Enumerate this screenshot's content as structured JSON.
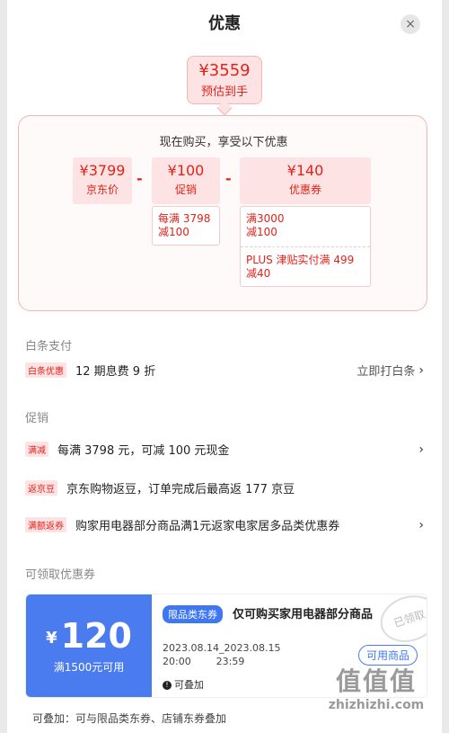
{
  "header": {
    "title": "优惠",
    "close_icon": "×"
  },
  "estimate": {
    "price": "¥3559",
    "label": "预估到手"
  },
  "calc": {
    "heading": "现在购买，享受以下优惠",
    "base": {
      "value": "¥3799",
      "label": "京东价"
    },
    "minus1": "-",
    "promo": {
      "value": "¥100",
      "label": "促销"
    },
    "minus2": "-",
    "coupon": {
      "value": "¥140",
      "label": "优惠券"
    },
    "promo_detail": [
      "每满 3798",
      "减100"
    ],
    "coupon_detail_1": [
      "满3000",
      "减100"
    ],
    "coupon_detail_2": [
      "PLUS 津贴实付满 499",
      "减40"
    ]
  },
  "baitiao": {
    "section_label": "白条支付",
    "tag": "白条优惠",
    "text": "12 期息费 9 折",
    "action": "立即打白条",
    "chevron": "›"
  },
  "promotions": {
    "section_label": "促销",
    "items": [
      {
        "tag": "满减",
        "text": "每满 3798 元，可减 100 元现金",
        "chevron": "›"
      },
      {
        "tag": "返京豆",
        "text": "京东购物返豆，订单完成后最高返 177 京豆",
        "chevron": ""
      },
      {
        "tag": "满额返券",
        "text": "购家用电器部分商品满1元返家电家居多品类优惠券",
        "chevron": "›"
      }
    ]
  },
  "coupons": {
    "section_label": "可领取优惠券",
    "card": {
      "yen": "¥",
      "amount": "120",
      "condition": "满1500元可用",
      "category_tag": "限品类东券",
      "title": "仅可购买家用电器部分商品",
      "date_line1": "2023.08.14_2023.08.15",
      "date_line2": "20:00        23:59",
      "stackable": "可叠加",
      "claimed_stamp": "已领取",
      "usable_button": "可用商品"
    },
    "footer_note": "可叠加：可与限品类东券、店铺东券叠加"
  },
  "watermark": {
    "logo": "值值值",
    "site": "zhizhizhi.com"
  },
  "colors": {
    "accent_red": "#e2231a",
    "coupon_blue": "#4a7cf0",
    "pink_bg": "#fde3e3"
  }
}
